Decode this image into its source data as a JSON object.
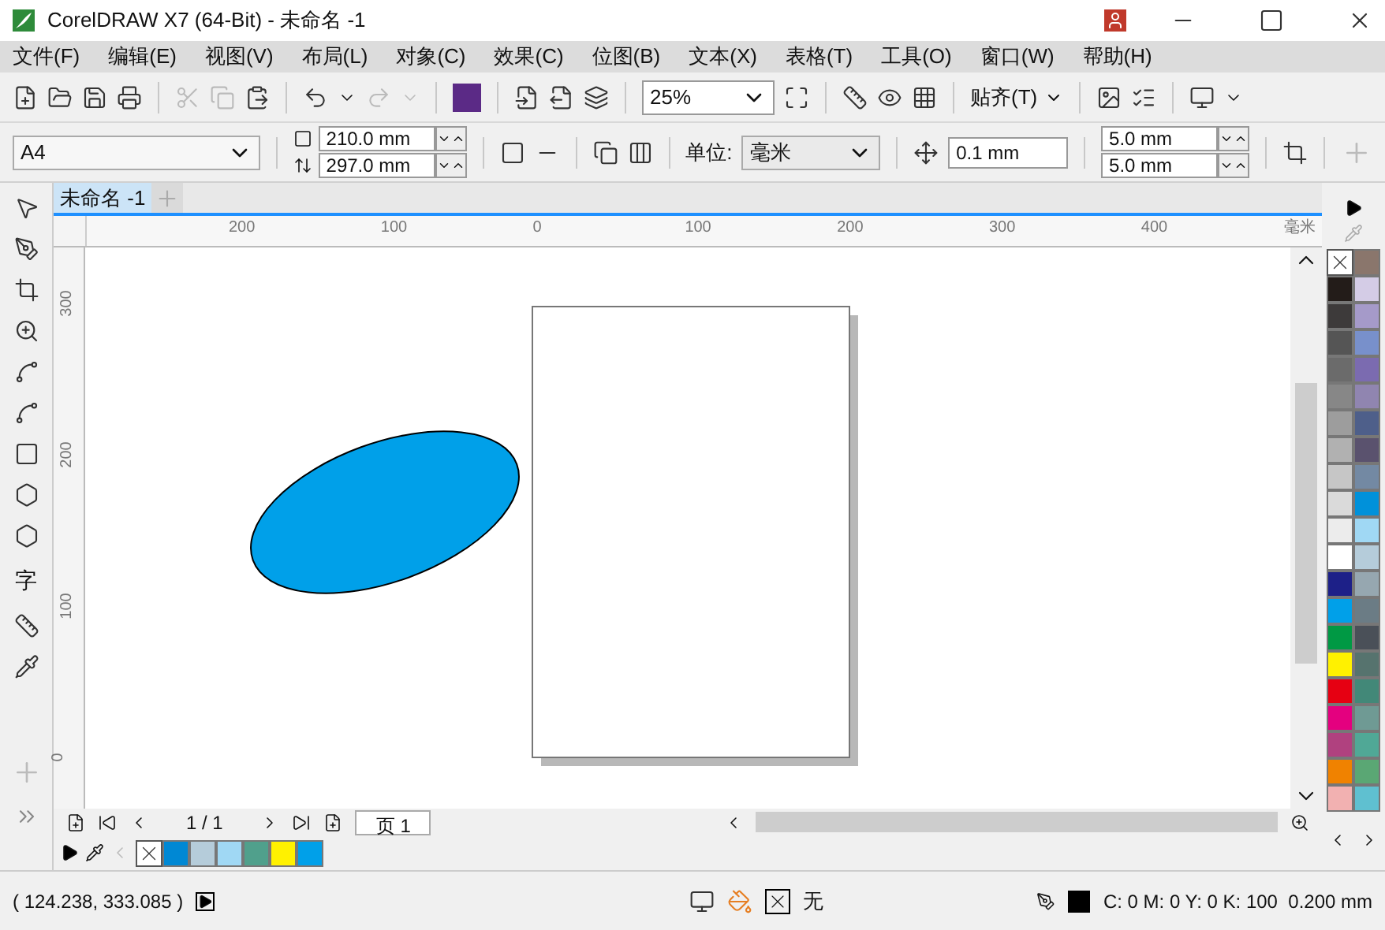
{
  "window": {
    "title": "CorelDRAW X7 (64-Bit) - 未命名 -1"
  },
  "menu": [
    "文件(F)",
    "编辑(E)",
    "视图(V)",
    "布局(L)",
    "对象(C)",
    "效果(C)",
    "位图(B)",
    "文本(X)",
    "表格(T)",
    "工具(O)",
    "窗口(W)",
    "帮助(H)"
  ],
  "toolbar": {
    "zoom": "25%",
    "snap": "贴齐(T)"
  },
  "toolbox": {
    "text_tool": "字"
  },
  "property_bar": {
    "page_size": "A4",
    "width": "210.0 mm",
    "height": "297.0 mm",
    "units_label": "单位:",
    "units": "毫米",
    "nudge": "0.1 mm",
    "dup_x": "5.0 mm",
    "dup_y": "5.0 mm"
  },
  "document_tabs": [
    {
      "label": "未命名 -1",
      "selected": true
    }
  ],
  "rulers": {
    "horizontal": [
      "200",
      "100",
      "0",
      "100",
      "200",
      "300",
      "400"
    ],
    "units": "毫米",
    "vertical": [
      "300",
      "200",
      "100",
      "0"
    ]
  },
  "page_nav": {
    "counter": "1 / 1",
    "pages": [
      {
        "label": "页 1",
        "selected": true
      }
    ]
  },
  "document_palette": [
    {
      "kind": "none"
    },
    {
      "kind": "color",
      "color": "#0088d4"
    },
    {
      "kind": "color",
      "color": "#b5ccda"
    },
    {
      "kind": "color",
      "color": "#a0d8f4"
    },
    {
      "kind": "color",
      "color": "#50a08c"
    },
    {
      "kind": "color",
      "color": "#fff100"
    },
    {
      "kind": "color",
      "color": "#00a0e9"
    }
  ],
  "palette": {
    "left": [
      {
        "kind": "none"
      },
      {
        "kind": "color",
        "color": "#231c19"
      },
      {
        "kind": "color",
        "color": "#3d3a3a"
      },
      {
        "kind": "color",
        "color": "#555555"
      },
      {
        "kind": "color",
        "color": "#6b6b6b"
      },
      {
        "kind": "color",
        "color": "#878787"
      },
      {
        "kind": "color",
        "color": "#9d9d9d"
      },
      {
        "kind": "color",
        "color": "#b1b1b1"
      },
      {
        "kind": "color",
        "color": "#c6c6c6"
      },
      {
        "kind": "color",
        "color": "#dadada"
      },
      {
        "kind": "color",
        "color": "#ececec"
      },
      {
        "kind": "color",
        "color": "#ffffff"
      },
      {
        "kind": "color",
        "color": "#1d2088"
      },
      {
        "kind": "color",
        "color": "#00a0e9"
      },
      {
        "kind": "color",
        "color": "#009944"
      },
      {
        "kind": "color",
        "color": "#fff100"
      },
      {
        "kind": "color",
        "color": "#e60012"
      },
      {
        "kind": "color",
        "color": "#e4007f"
      },
      {
        "kind": "color",
        "color": "#b0417f"
      },
      {
        "kind": "color",
        "color": "#f08200"
      },
      {
        "kind": "color",
        "color": "#f2b1b1"
      }
    ],
    "right": [
      {
        "kind": "color",
        "color": "#8a766c"
      },
      {
        "kind": "color",
        "color": "#d4cce6"
      },
      {
        "kind": "color",
        "color": "#a59ac9"
      },
      {
        "kind": "color",
        "color": "#7890cb"
      },
      {
        "kind": "color",
        "color": "#7b6bb0"
      },
      {
        "kind": "color",
        "color": "#9085b0"
      },
      {
        "kind": "color",
        "color": "#4e5f8a"
      },
      {
        "kind": "color",
        "color": "#5a526e"
      },
      {
        "kind": "color",
        "color": "#7389a3"
      },
      {
        "kind": "color",
        "color": "#0091da"
      },
      {
        "kind": "color",
        "color": "#a0d8f4"
      },
      {
        "kind": "color",
        "color": "#b5ccda"
      },
      {
        "kind": "color",
        "color": "#96a7b0"
      },
      {
        "kind": "color",
        "color": "#6b7c85"
      },
      {
        "kind": "color",
        "color": "#4a5058"
      },
      {
        "kind": "color",
        "color": "#56736e"
      },
      {
        "kind": "color",
        "color": "#428878"
      },
      {
        "kind": "color",
        "color": "#6f9a94"
      },
      {
        "kind": "color",
        "color": "#50a896"
      },
      {
        "kind": "color",
        "color": "#5aa774"
      },
      {
        "kind": "color",
        "color": "#5fc0d0"
      }
    ]
  },
  "status": {
    "coordinates": "( 124.238, 333.085 )",
    "fill": "无",
    "outline": "C: 0 M: 0 Y: 0 K: 100  0.200 mm"
  }
}
